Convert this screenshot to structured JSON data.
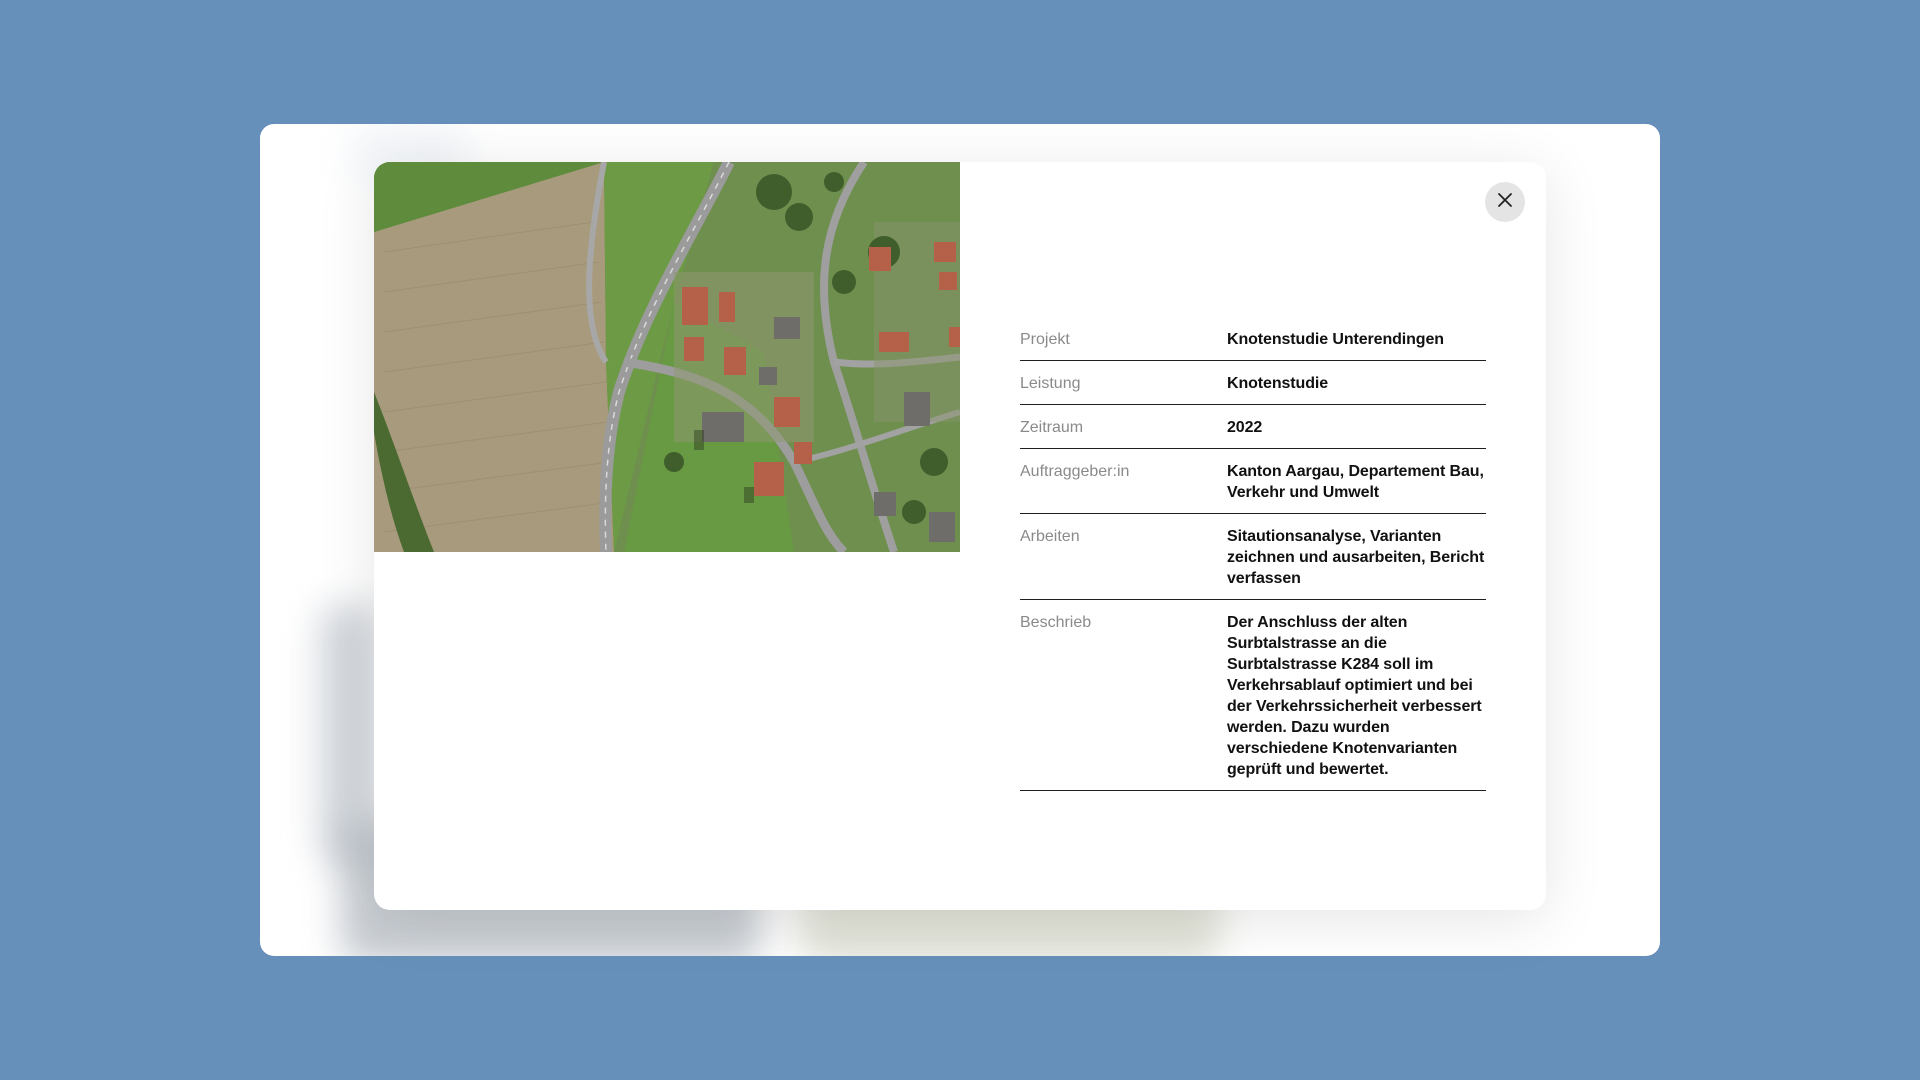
{
  "modal": {
    "image": {
      "kind": "aerial-photo",
      "alt_subject": "Aerial view of road junction and village"
    },
    "close_icon": "close-icon",
    "details": [
      {
        "label": "Projekt",
        "value": "Knotenstudie Unterendingen"
      },
      {
        "label": "Leistung",
        "value": "Knotenstudie"
      },
      {
        "label": "Zeitraum",
        "value": "2022"
      },
      {
        "label": "Auftraggeber:in",
        "value": "Kanton Aargau, Departement Bau, Verkehr und Umwelt"
      },
      {
        "label": "Arbeiten",
        "value": "Sitautionsanalyse, Varianten zeichnen und ausarbeiten, Bericht verfassen"
      },
      {
        "label": "Beschrieb",
        "value": "Der Anschluss der alten Surbtalstrasse an die Surbtalstrasse K284 soll im Verkehrsablauf optimiert und bei der Verkehrssicherheit verbessert werden. Dazu wurden verschiedene Knotenvarianten geprüft und bewertet."
      }
    ]
  },
  "colors": {
    "page_background": "#6690ba",
    "card_background": "#ffffff",
    "label_text": "#8a8a8a",
    "value_text": "#111111",
    "divider": "#1f1f1f"
  }
}
